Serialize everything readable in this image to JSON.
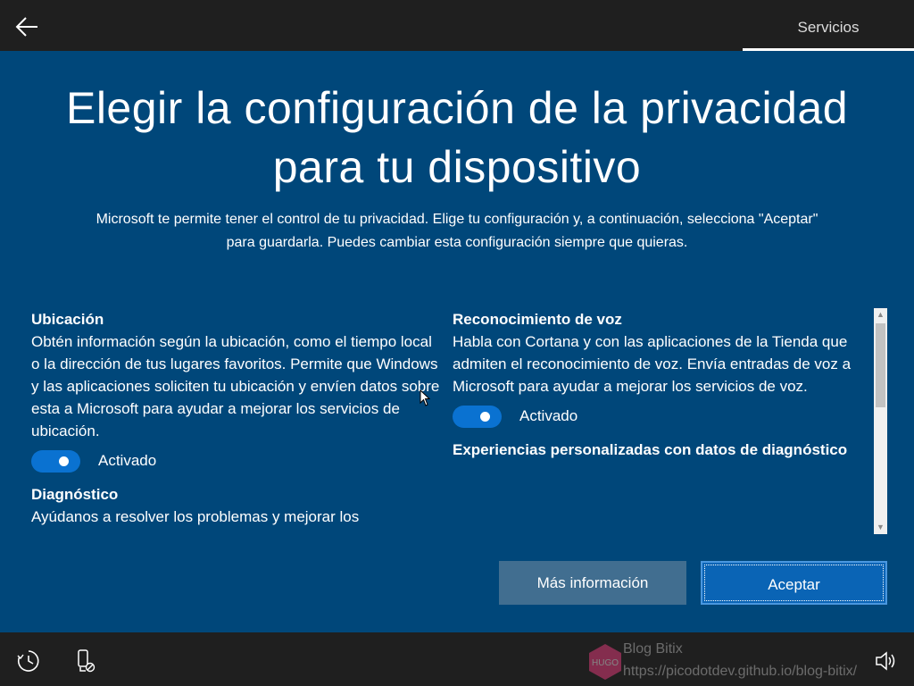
{
  "header": {
    "back_icon": "arrow-left-icon",
    "tab_label": "Servicios"
  },
  "main": {
    "title_line1": "Elegir la configuración de la privacidad",
    "title_line2": "para tu dispositivo",
    "subtitle_line1": "Microsoft te permite tener el control de tu privacidad. Elige tu configuración y, a continuación, selecciona \"Aceptar\"",
    "subtitle_line2": "para guardarla. Puedes cambiar esta configuración siempre que quieras."
  },
  "settings": {
    "left": [
      {
        "title": "Ubicación",
        "description": "Obtén información según la ubicación, como el tiempo local o la dirección de tus lugares favoritos. Permite que Windows y las aplicaciones soliciten tu ubicación y envíen datos sobre esta a Microsoft para ayudar a mejorar los servicios de ubicación.",
        "toggle_state": "Activado"
      },
      {
        "title": "Diagnóstico",
        "description": "Ayúdanos a resolver los problemas y mejorar los"
      }
    ],
    "right": [
      {
        "title": "Reconocimiento de voz",
        "description": "Habla con Cortana y con las aplicaciones de la Tienda que admiten el reconocimiento de voz. Envía entradas de voz a Microsoft para ayudar a mejorar los servicios de voz.",
        "toggle_state": "Activado"
      },
      {
        "title": "Experiencias personalizadas con datos de diagnóstico"
      }
    ]
  },
  "buttons": {
    "more_info": "Más información",
    "accept": "Aceptar"
  },
  "footer": {
    "icons": [
      "ease-of-access-icon",
      "input-device-icon",
      "volume-icon"
    ]
  },
  "watermark": {
    "badge": "HUGO",
    "title": "Blog Bitix",
    "url": "https://picodotdev.github.io/blog-bitix/"
  },
  "colors": {
    "background": "#00477a",
    "bars": "#1f1f1f",
    "toggle_on": "#0a72d1",
    "accept_button": "#0a64b5",
    "more_button": "#416e90"
  }
}
